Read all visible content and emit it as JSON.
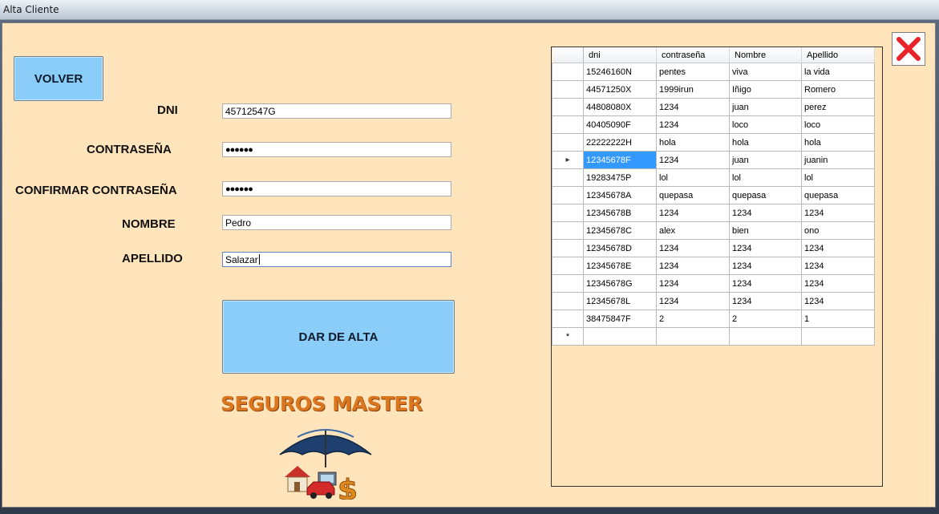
{
  "window": {
    "title": "Alta Cliente"
  },
  "form": {
    "volver_label": "VOLVER",
    "dni_label": "DNI",
    "dni_value": "45712547G",
    "contrasena_label": "CONTRASEÑA",
    "contrasena_value": "●●●●●●",
    "confirmar_label": "CONFIRMAR CONTRASEÑA",
    "confirmar_value": "●●●●●●",
    "nombre_label": "NOMBRE",
    "nombre_value": "Pedro",
    "apellido_label": "APELLIDO",
    "apellido_value": "Salazar",
    "submit_label": "DAR DE ALTA"
  },
  "brand": {
    "name": "SEGUROS MASTER"
  },
  "grid": {
    "columns": [
      "dni",
      "contraseña",
      "Nombre",
      "Apellido"
    ],
    "rows": [
      [
        "15246160N",
        "pentes",
        "viva",
        "la vida"
      ],
      [
        "44571250X",
        "1999irun",
        "Iñigo",
        "Romero"
      ],
      [
        "44808080X",
        "1234",
        "juan",
        "perez"
      ],
      [
        "40405090F",
        "1234",
        "loco",
        "loco"
      ],
      [
        "22222222H",
        "hola",
        "hola",
        "hola"
      ],
      [
        "12345678F",
        "1234",
        "juan",
        "juanin"
      ],
      [
        "19283475P",
        "lol",
        "lol",
        "lol"
      ],
      [
        "12345678A",
        "quepasa",
        "quepasa",
        "quepasa"
      ],
      [
        "12345678B",
        "1234",
        "1234",
        "1234"
      ],
      [
        "12345678C",
        "alex",
        "bien",
        "ono"
      ],
      [
        "12345678D",
        "1234",
        "1234",
        "1234"
      ],
      [
        "12345678E",
        "1234",
        "1234",
        "1234"
      ],
      [
        "12345678G",
        "1234",
        "1234",
        "1234"
      ],
      [
        "12345678L",
        "1234",
        "1234",
        "1234"
      ],
      [
        "38475847F",
        "2",
        "2",
        "1"
      ]
    ],
    "selected_row": 5,
    "current_row_marker": "▸",
    "new_row_marker": "*"
  },
  "colors": {
    "background": "#ffe4bc",
    "button": "#89cdf8",
    "selection": "#3399ff",
    "close": "#e8232a"
  },
  "icons": {
    "close": "close-icon",
    "logo": "umbrella-house-car-dollar-logo"
  }
}
